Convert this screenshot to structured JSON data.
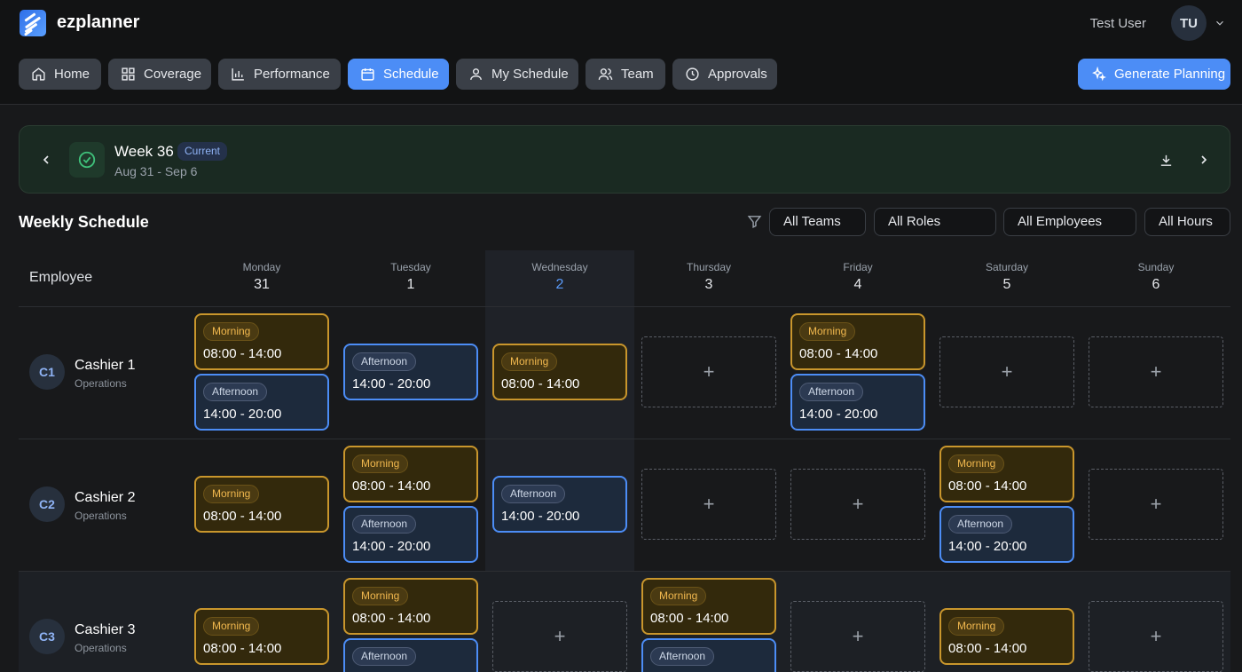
{
  "app": {
    "name": "ezplanner",
    "user_name": "Test User",
    "user_initials": "TU"
  },
  "nav": [
    {
      "label": "Home",
      "icon": "home-icon"
    },
    {
      "label": "Coverage",
      "icon": "grid-icon"
    },
    {
      "label": "Performance",
      "icon": "bar-chart-icon"
    },
    {
      "label": "Schedule",
      "icon": "calendar-icon",
      "active": true
    },
    {
      "label": "My Schedule",
      "icon": "user-icon"
    },
    {
      "label": "Team",
      "icon": "users-icon"
    },
    {
      "label": "Approvals",
      "icon": "clock-icon"
    }
  ],
  "generate_label": "Generate Planning",
  "week": {
    "title": "Week 36",
    "badge": "Current",
    "range": "Aug 31 - Sep 6"
  },
  "schedule": {
    "title": "Weekly Schedule",
    "filters": [
      "All Teams",
      "All Roles",
      "All Employees",
      "All Hours"
    ],
    "employee_header": "Employee",
    "days": [
      {
        "name": "Monday",
        "num": "31"
      },
      {
        "name": "Tuesday",
        "num": "1"
      },
      {
        "name": "Wednesday",
        "num": "2",
        "today": true
      },
      {
        "name": "Thursday",
        "num": "3"
      },
      {
        "name": "Friday",
        "num": "4"
      },
      {
        "name": "Saturday",
        "num": "5"
      },
      {
        "name": "Sunday",
        "num": "6"
      }
    ],
    "employees": [
      {
        "initials": "C1",
        "name": "Cashier 1",
        "team": "Operations",
        "shifts": [
          [
            "Morning",
            "Afternoon"
          ],
          [
            "Afternoon"
          ],
          [
            "Morning"
          ],
          [],
          [
            "Morning",
            "Afternoon"
          ],
          [],
          []
        ]
      },
      {
        "initials": "C2",
        "name": "Cashier 2",
        "team": "Operations",
        "shifts": [
          [
            "Morning"
          ],
          [
            "Morning",
            "Afternoon"
          ],
          [
            "Afternoon"
          ],
          [],
          [],
          [
            "Morning",
            "Afternoon"
          ],
          []
        ]
      },
      {
        "initials": "C3",
        "name": "Cashier 3",
        "team": "Operations",
        "shifts": [
          [
            "Morning"
          ],
          [
            "Morning",
            "Afternoon"
          ],
          [],
          [
            "Morning",
            "Afternoon"
          ],
          [],
          [
            "Morning"
          ],
          []
        ]
      }
    ],
    "shift_types": {
      "Morning": {
        "label": "Morning",
        "time": "08:00 - 14:00",
        "color": "#c9962c"
      },
      "Afternoon": {
        "label": "Afternoon",
        "time": "14:00 - 20:00",
        "color": "#4c8df6"
      }
    },
    "add_symbol": "+"
  }
}
